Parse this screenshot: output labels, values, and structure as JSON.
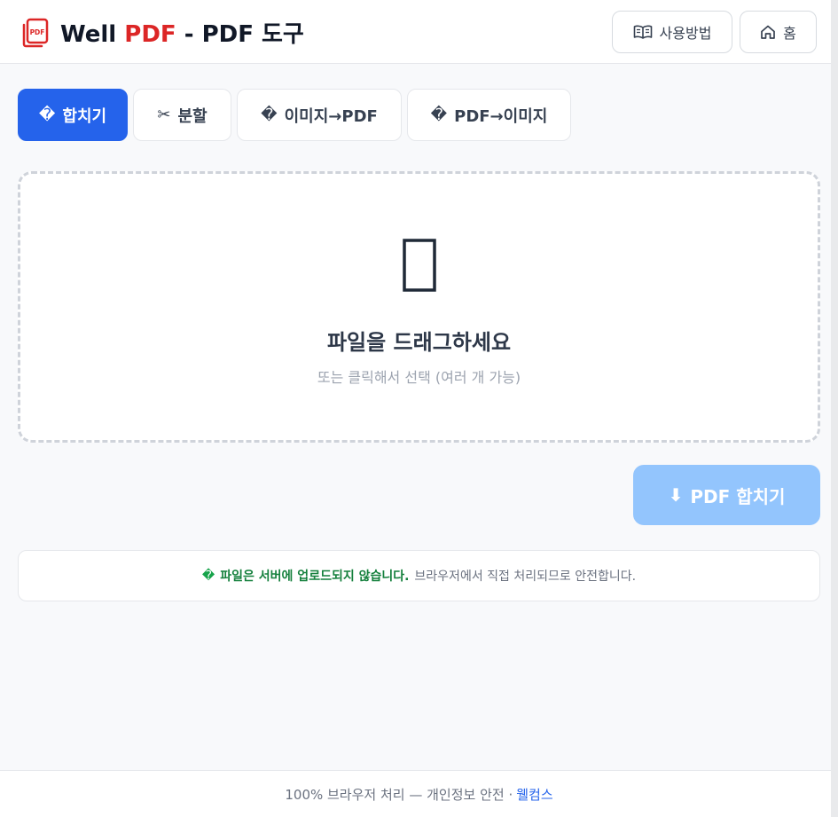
{
  "header": {
    "logo_text": "PDF",
    "title_prefix": "Well ",
    "title_accent": "PDF",
    "title_suffix": " - PDF 도구",
    "guide_button": {
      "icon": "book-icon",
      "label": "사용방법"
    },
    "home_button": {
      "icon": "home-icon",
      "label": "홈"
    }
  },
  "tabs": [
    {
      "icon": "�",
      "label": "합치기",
      "active": true
    },
    {
      "icon": "✂",
      "label": "분할",
      "active": false
    },
    {
      "icon": "�",
      "label": "이미지→PDF",
      "active": false
    },
    {
      "icon": "�",
      "label": "PDF→이미지",
      "active": false
    }
  ],
  "dropzone": {
    "icon": "file-placeholder-icon",
    "title": "파일을 드래그하세요",
    "subtitle": "또는 클릭해서 선택 (여러 개 가능)"
  },
  "action_button": {
    "icon": "⬇",
    "label": "PDF 합치기",
    "enabled": false
  },
  "notice": {
    "icon": "�",
    "strong": "파일은 서버에 업로드되지 않습니다.",
    "text": "브라우저에서 직접 처리되므로 안전합니다."
  },
  "footer": {
    "text": "100% 브라우저 처리 — 개인정보 안전 ·",
    "link": "웰컴스"
  },
  "colors": {
    "accent": "#2563eb",
    "brand_red": "#dc2626",
    "disabled_button": "#93c5fd",
    "safe_green": "#15803d"
  }
}
